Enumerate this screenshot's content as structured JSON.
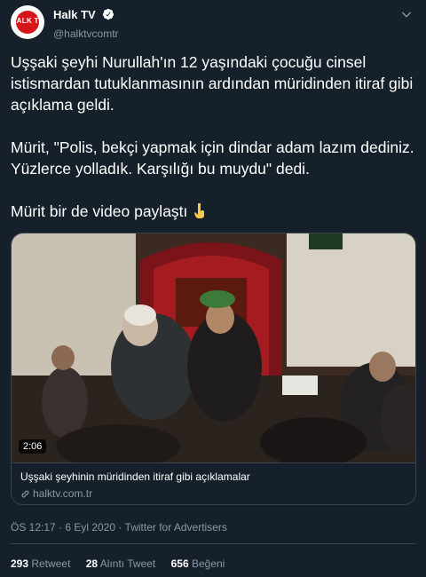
{
  "account": {
    "avatar_text": "HALK TV",
    "display_name": "Halk TV",
    "handle": "@halktvcomtr"
  },
  "tweet": {
    "paragraphs": [
      "Uşşaki şeyhi Nurullah'ın 12 yaşındaki çocuğu cinsel istismardan tutuklanmasının ardından müridinden itiraf gibi açıklama geldi.",
      "Mürit, \"Polis, bekçi yapmak için dindar adam lazım dediniz. Yüzlerce yolladık. Karşılığı bu muydu\" dedi.",
      "Mürit bir de video paylaştı"
    ]
  },
  "card": {
    "duration": "2:06",
    "title": "Uşşaki şeyhinin müridinden itiraf gibi açıklamalar",
    "domain": "halktv.com.tr"
  },
  "meta": {
    "timestamp": "ÖS 12:17 · 6 Eyl 2020 · Twitter for Advertisers"
  },
  "stats": {
    "retweets": "293",
    "retweets_label": "Retweet",
    "quotes": "28",
    "quotes_label": "Alıntı Tweet",
    "likes": "656",
    "likes_label": "Beğeni"
  },
  "colors": {
    "background": "#15202b",
    "secondary_text": "#8899a6",
    "border": "#38444d",
    "verified": "#ffffff",
    "brand_red": "#d7141a"
  }
}
